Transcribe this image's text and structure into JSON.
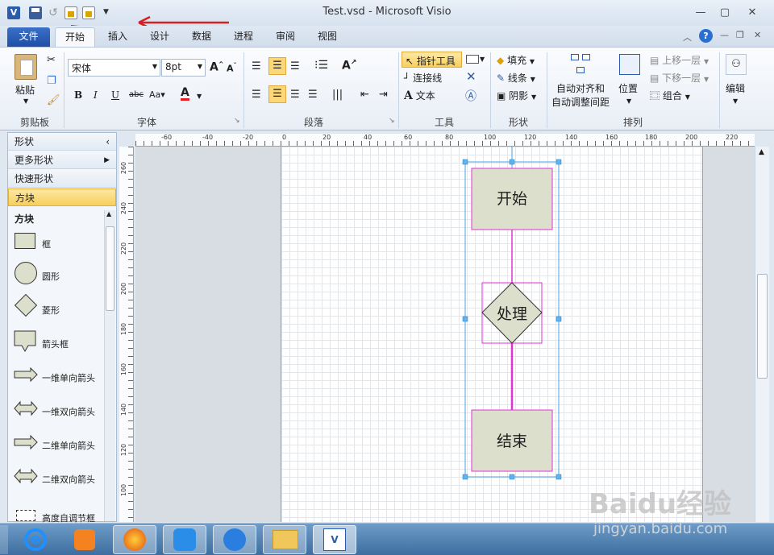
{
  "window": {
    "title": "Test.vsd - Microsoft Visio"
  },
  "tabs": [
    "文件",
    "开始",
    "插入",
    "设计",
    "数据",
    "进程",
    "审阅",
    "视图"
  ],
  "ribbon": {
    "clipboard": {
      "paste": "粘贴",
      "label": "剪贴板"
    },
    "font": {
      "name": "宋体",
      "size": "8pt",
      "label": "字体"
    },
    "paragraph": {
      "label": "段落"
    },
    "tools": {
      "pointer": "指针工具",
      "connector": "连接线",
      "text": "文本",
      "label": "工具"
    },
    "shape": {
      "fill": "填充",
      "line": "线条",
      "shadow": "阴影",
      "label": "形状"
    },
    "arrange": {
      "auto_align": "自动对齐和",
      "auto_space": "自动调整间距",
      "position": "位置",
      "bring_forward": "上移一层",
      "send_backward": "下移一层",
      "group": "组合",
      "label": "排列"
    },
    "editing": {
      "label": "编辑"
    }
  },
  "shapes_panel": {
    "header": "形状",
    "more_shapes": "更多形状",
    "quick_shapes": "快速形状",
    "stencil": "方块",
    "stencil_title": "方块",
    "items": [
      "框",
      "圆形",
      "菱形",
      "箭头框",
      "一维单向箭头",
      "一维双向箭头",
      "二维单向箭头",
      "二维双向箭头",
      "高度自调节框"
    ]
  },
  "ruler": {
    "h_ticks": [
      "-60",
      "-40",
      "-20",
      "0",
      "20",
      "40",
      "60",
      "80",
      "100",
      "120",
      "140",
      "160",
      "180",
      "200",
      "220"
    ],
    "v_ticks": [
      "260",
      "240",
      "220",
      "200",
      "180",
      "160",
      "140",
      "120",
      "100"
    ]
  },
  "diagram": {
    "start": "开始",
    "process": "处理",
    "end": "结束"
  },
  "colors": {
    "shape_fill": "#dcdfcc",
    "selection": "#e033d6",
    "accent": "#2a5caa"
  },
  "watermark": {
    "brand": "Baidu经验",
    "url": "jingyan.baidu.com"
  }
}
